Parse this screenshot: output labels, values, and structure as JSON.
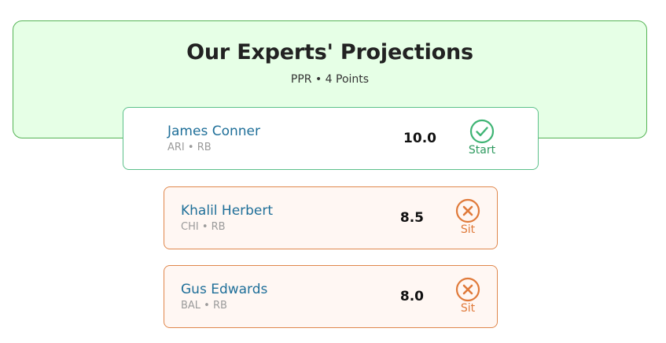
{
  "header": {
    "title": "Our Experts' Projections",
    "subtitle": "PPR • 4 Points"
  },
  "players": [
    {
      "name": "James Conner",
      "team_pos": "ARI • RB",
      "projection": "10.0",
      "verdict": "Start",
      "verdict_icon": "check-circle-icon"
    },
    {
      "name": "Khalil Herbert",
      "team_pos": "CHI • RB",
      "projection": "8.5",
      "verdict": "Sit",
      "verdict_icon": "x-circle-icon"
    },
    {
      "name": "Gus Edwards",
      "team_pos": "BAL • RB",
      "projection": "8.0",
      "verdict": "Sit",
      "verdict_icon": "x-circle-icon"
    }
  ],
  "colors": {
    "start_accent": "#2e9a5f",
    "sit_accent": "#e07a3a",
    "header_bg": "#e6ffe6",
    "name_color": "#1f6f99"
  }
}
